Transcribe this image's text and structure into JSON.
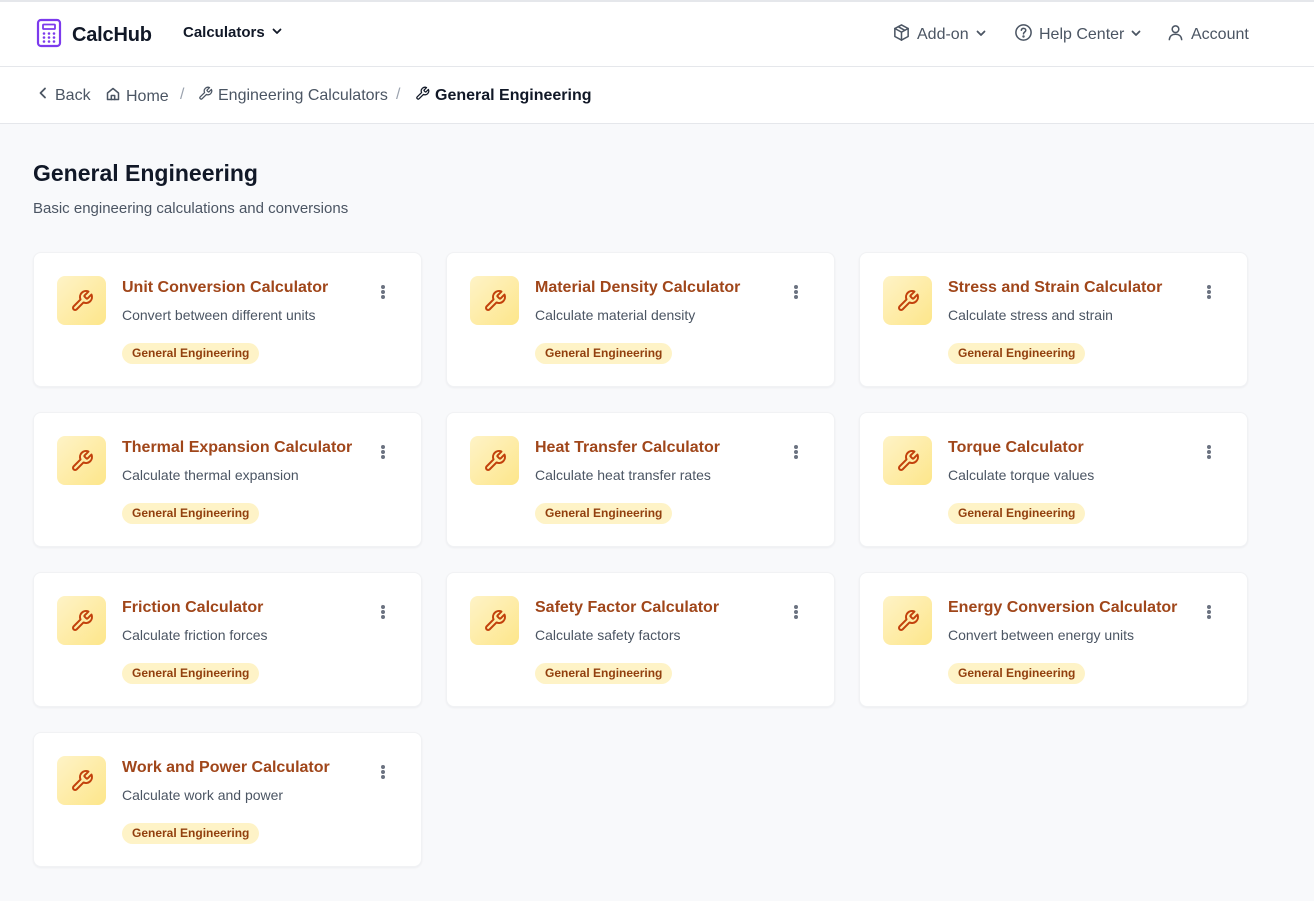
{
  "app": {
    "name": "CalcHub",
    "brand_color": "#7c3aed"
  },
  "navbar": {
    "calculators_label": "Calculators",
    "addon_label": "Add-on",
    "help_label": "Help Center",
    "account_label": "Account"
  },
  "breadcrumb": {
    "back_label": "Back",
    "home_label": "Home",
    "engineering_label": "Engineering Calculators",
    "current_label": "General Engineering"
  },
  "page": {
    "title": "General Engineering",
    "subtitle": "Basic engineering calculations and conversions"
  },
  "cards": [
    {
      "title": "Unit Conversion Calculator",
      "description": "Convert between different units",
      "tag": "General Engineering",
      "icon": "wrench-icon"
    },
    {
      "title": "Material Density Calculator",
      "description": "Calculate material density",
      "tag": "General Engineering",
      "icon": "wrench-icon"
    },
    {
      "title": "Stress and Strain Calculator",
      "description": "Calculate stress and strain",
      "tag": "General Engineering",
      "icon": "wrench-icon"
    },
    {
      "title": "Thermal Expansion Calculator",
      "description": "Calculate thermal expansion",
      "tag": "General Engineering",
      "icon": "wrench-icon"
    },
    {
      "title": "Heat Transfer Calculator",
      "description": "Calculate heat transfer rates",
      "tag": "General Engineering",
      "icon": "wrench-icon"
    },
    {
      "title": "Torque Calculator",
      "description": "Calculate torque values",
      "tag": "General Engineering",
      "icon": "wrench-icon"
    },
    {
      "title": "Friction Calculator",
      "description": "Calculate friction forces",
      "tag": "General Engineering",
      "icon": "wrench-icon"
    },
    {
      "title": "Safety Factor Calculator",
      "description": "Calculate safety factors",
      "tag": "General Engineering",
      "icon": "wrench-icon"
    },
    {
      "title": "Energy Conversion Calculator",
      "description": "Convert between energy units",
      "tag": "General Engineering",
      "icon": "wrench-icon"
    },
    {
      "title": "Work and Power Calculator",
      "description": "Calculate work and power",
      "tag": "General Engineering",
      "icon": "wrench-icon"
    }
  ],
  "colors": {
    "accent_text": "#a0461a",
    "tag_background": "#fef3c7",
    "tag_text": "#92400e",
    "icon_stroke": "#c2410c"
  }
}
